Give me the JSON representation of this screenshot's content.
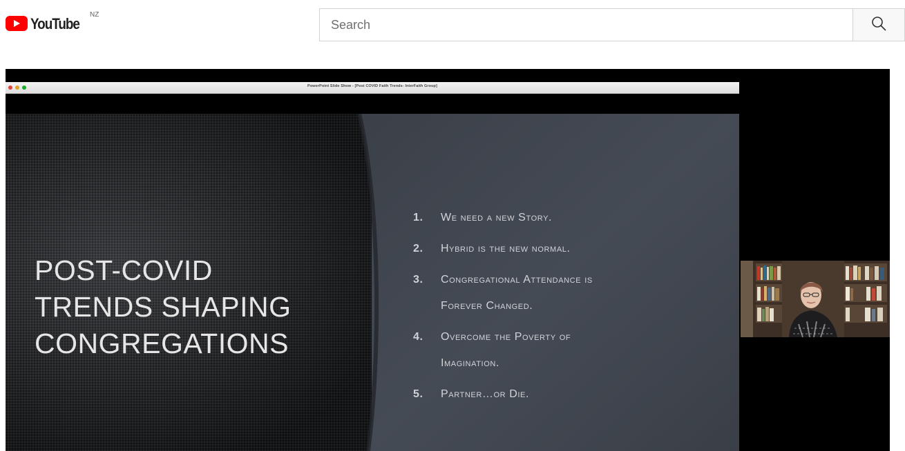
{
  "masthead": {
    "logo_text": "YouTube",
    "country_code": "NZ",
    "search_placeholder": "Search",
    "icons": {
      "logo": "youtube-play-icon",
      "search": "search-icon"
    },
    "colors": {
      "brand_red": "#ff0000"
    }
  },
  "player": {
    "window_title": "PowerPoint Slide Show - [Post COVID Faith Trends- InterFaith Group]",
    "slide": {
      "heading_lines": [
        "POST-COVID",
        "TRENDS SHAPING",
        "CONGREGATIONS"
      ],
      "items": [
        {
          "number": "1.",
          "lines": [
            "We need a new Story."
          ]
        },
        {
          "number": "2.",
          "lines": [
            "Hybrid is the new normal."
          ]
        },
        {
          "number": "3.",
          "lines": [
            "Congregational Attendance is",
            "Forever Changed."
          ]
        },
        {
          "number": "4.",
          "lines": [
            "Overcome the Poverty of",
            "Imagination."
          ]
        },
        {
          "number": "5.",
          "lines": [
            "Partner…or Die."
          ]
        }
      ]
    },
    "speaker_video": {
      "icon": "person-video-icon"
    }
  }
}
